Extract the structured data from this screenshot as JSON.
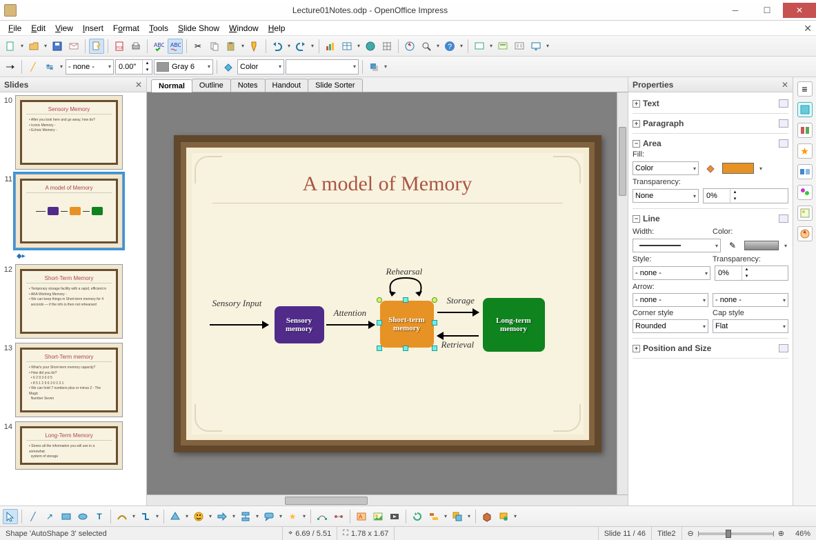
{
  "window": {
    "title": "Lecture01Notes.odp - OpenOffice Impress"
  },
  "menu": [
    "File",
    "Edit",
    "View",
    "Insert",
    "Format",
    "Tools",
    "Slide Show",
    "Window",
    "Help"
  ],
  "toolbar2": {
    "style_combo": "- none -",
    "width_spin": "0.00\"",
    "color_name": "Gray 6",
    "fill_type": "Color"
  },
  "slides_panel": {
    "title": "Slides",
    "items": [
      {
        "num": "10",
        "title": "Sensory Memory",
        "lines": [
          "After you look at this slide and go away, how do?",
          "Iconic Memory -",
          "Echoic Memory -"
        ]
      },
      {
        "num": "11",
        "title": "A model of Memory",
        "diagram": true
      },
      {
        "num": "12",
        "title": "Short-Term Memory",
        "lines": [
          "Temporary storage facility with a rapid, efficient in",
          "AKA Working Memory -",
          "We can keep things in Short-term memory for 4",
          "seconds — if the info is then not rehearsed"
        ]
      },
      {
        "num": "13",
        "title": "Short-Term memory",
        "lines": [
          "What's your Short-term memory capacity?",
          "How did you do?",
          "6 2 9 3 6 0 5",
          "8 5 1 2 9 6 3 0 2 3 1",
          "We can hold 7 numbers plus or minus 2 - The Magic",
          "Number Seven"
        ]
      },
      {
        "num": "14",
        "title": "Long-Term Memory",
        "lines": [
          "Stores all the information you will use in a somewhat",
          "system of storage"
        ]
      }
    ],
    "selected_index": 1
  },
  "view_tabs": [
    "Normal",
    "Outline",
    "Notes",
    "Handout",
    "Slide Sorter"
  ],
  "slide": {
    "title": "A model of Memory",
    "labels": {
      "sensory_input": "Sensory Input",
      "attention": "Attention",
      "rehearsal": "Rehearsal",
      "storage": "Storage",
      "retrieval": "Retrieval"
    },
    "boxes": {
      "sensory": "Sensory\nmemory",
      "shortterm": "Short-term\nmemory",
      "longterm": "Long-term\nmemory"
    }
  },
  "properties": {
    "title": "Properties",
    "sections": {
      "text": "Text",
      "paragraph": "Paragraph",
      "area": "Area",
      "line": "Line",
      "pos": "Position and Size"
    },
    "area": {
      "fill_label": "Fill:",
      "fill_type": "Color",
      "fill_swatch": "#e79224",
      "transparency_label": "Transparency:",
      "transparency_type": "None",
      "transparency_val": "0%"
    },
    "line": {
      "width_label": "Width:",
      "color_label": "Color:",
      "style_label": "Style:",
      "style_val": "- none -",
      "transparency_label": "Transparency:",
      "transparency_val": "0%",
      "arrow_label": "Arrow:",
      "arrow_left": "- none -",
      "arrow_right": "- none -",
      "corner_label": "Corner style",
      "corner_val": "Rounded",
      "cap_label": "Cap style",
      "cap_val": "Flat"
    }
  },
  "status": {
    "selection": "Shape 'AutoShape 3' selected",
    "pos": "6.69 / 5.51",
    "size": "1.78 x 1.67",
    "slide_count": "Slide 11 / 46",
    "template": "Title2",
    "zoom": "46%"
  }
}
